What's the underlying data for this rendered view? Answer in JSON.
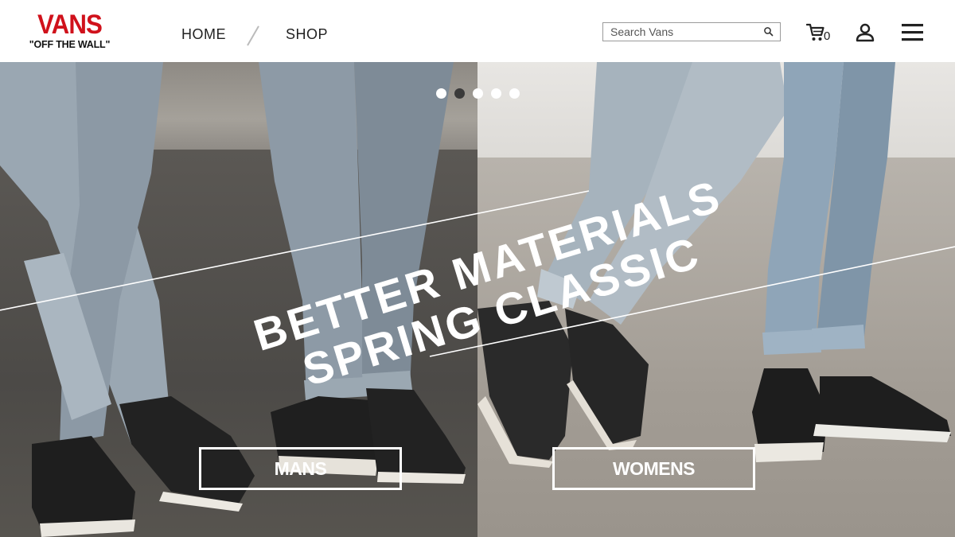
{
  "brand": {
    "logo_word": "VANS",
    "logo_tagline": "\"OFF THE WALL\"",
    "logo_color": "#d0111b"
  },
  "nav": {
    "items": [
      {
        "label": "HOME"
      },
      {
        "label": "SHOP"
      }
    ]
  },
  "search": {
    "placeholder": "Search Vans",
    "icon": "search-icon"
  },
  "cart": {
    "icon": "cart-icon",
    "count": "0"
  },
  "account": {
    "icon": "user-icon"
  },
  "menu": {
    "icon": "hamburger-menu-icon"
  },
  "hero": {
    "headline_line1": "BETTER MATERIALS",
    "headline_line2": "SPRING CLASSIC",
    "carousel": {
      "slide_count": 5,
      "active_index": 1
    },
    "buttons": {
      "mans": "MANS",
      "womens": "WOMENS"
    }
  }
}
